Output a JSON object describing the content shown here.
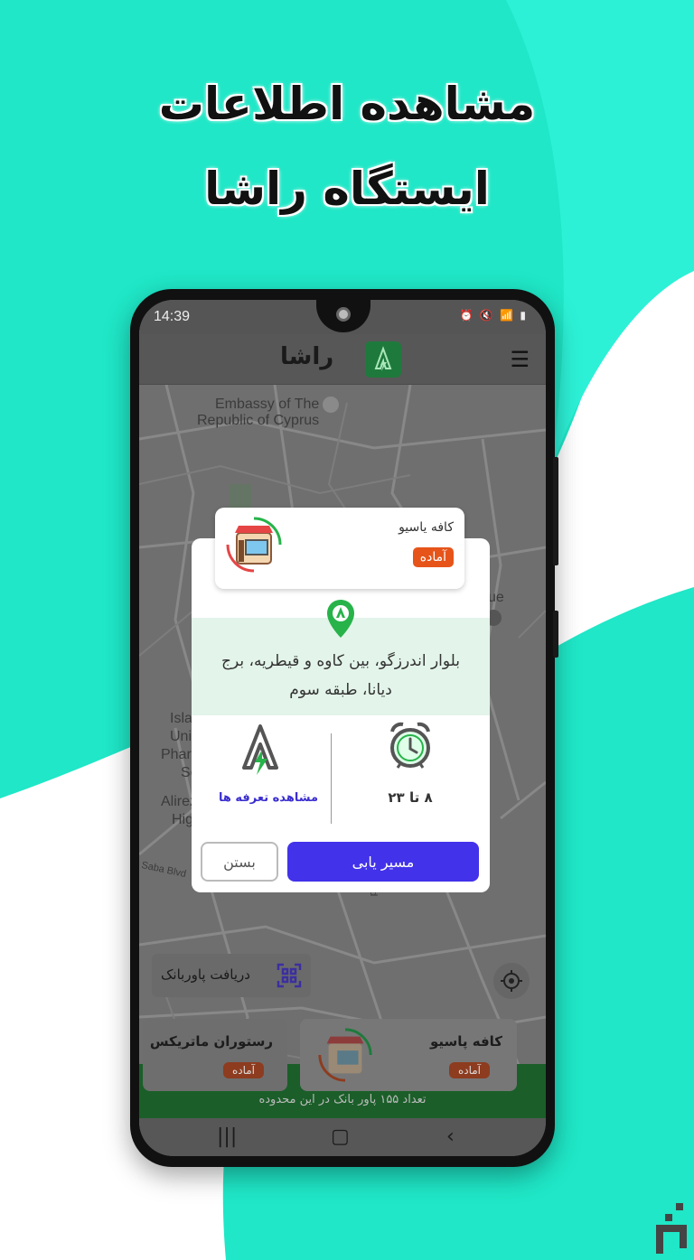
{
  "headline": {
    "line1": "مشاهده اطلاعات",
    "line2": "ایستگاه راشا"
  },
  "colors": {
    "accent_teal": "#1fe7c7",
    "route_button": "#4232ea",
    "ready_badge": "#e6541a",
    "brand_green": "#1e7a3c"
  },
  "statusbar": {
    "time": "14:39",
    "icons": "⏰ 🔇 📶 ▮"
  },
  "appbar": {
    "logo_text": "راشا",
    "menu_icon": "hamburger-menu-icon"
  },
  "map": {
    "labels": [
      "Embassy of The",
      "Republic of Cyprus",
      "Isla",
      "Uni",
      "Pharm",
      "Sc",
      "Alirez",
      "Hig",
      "Saba Blvd",
      "ue",
      "Blvd"
    ]
  },
  "station_card": {
    "name": "کافه یاسیو",
    "status": "آماده"
  },
  "dialog": {
    "address": "بلوار اندرزگو، بین کاوه و قیطریه، برج دیانا، طبقه سوم",
    "hours": "۸ تا ۲۳",
    "tariff_link": "مشاهده تعرفه ها",
    "route_button": "مسیر یابی",
    "close_button": "بستن"
  },
  "powerbank_button": {
    "label": "دریافت پاوربانک"
  },
  "nearby_stations": [
    {
      "name": "کافه پاسیو",
      "status": "آماده"
    },
    {
      "name": "رستوران ماتریکس",
      "status": "آماده"
    }
  ],
  "bottom_info": "تعداد ۱۵۵ پاور بانک در این محدوده"
}
